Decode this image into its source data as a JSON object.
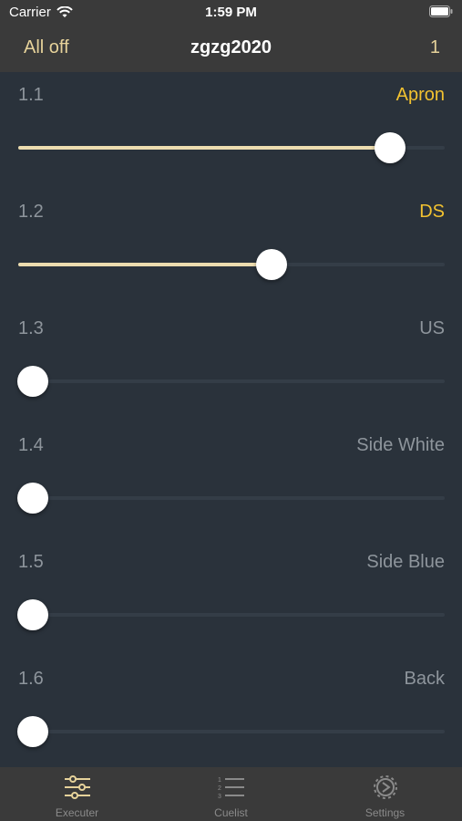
{
  "status_bar": {
    "carrier": "Carrier",
    "time": "1:59 PM"
  },
  "nav": {
    "left_button": "All off",
    "title": "zgzg2020",
    "right_value": "1"
  },
  "colors": {
    "accent": "#e6d29a",
    "active_name": "#f2c230",
    "track_fill": "#ecdcaf",
    "background": "#2a323b"
  },
  "faders": [
    {
      "number": "1.1",
      "name": "Apron",
      "level": 0.9,
      "active": true
    },
    {
      "number": "1.2",
      "name": "DS",
      "level": 0.6,
      "active": true
    },
    {
      "number": "1.3",
      "name": "US",
      "level": 0.0,
      "active": false
    },
    {
      "number": "1.4",
      "name": "Side White",
      "level": 0.0,
      "active": false
    },
    {
      "number": "1.5",
      "name": "Side Blue",
      "level": 0.0,
      "active": false
    },
    {
      "number": "1.6",
      "name": "Back",
      "level": 0.0,
      "active": false
    }
  ],
  "tabs": [
    {
      "label": "Executer",
      "icon": "sliders-icon",
      "selected": true
    },
    {
      "label": "Cuelist",
      "icon": "numbered-list-icon",
      "selected": false
    },
    {
      "label": "Settings",
      "icon": "gear-icon",
      "selected": false
    }
  ]
}
